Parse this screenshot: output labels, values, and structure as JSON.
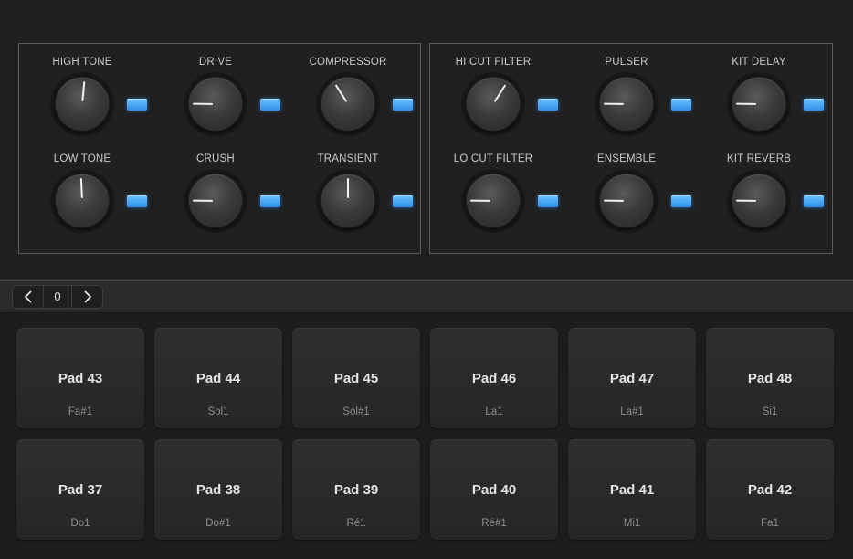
{
  "effects_left": [
    {
      "label": "HIGH TONE",
      "value": 0.52
    },
    {
      "label": "DRIVE",
      "value": 0.17
    },
    {
      "label": "COMPRESSOR",
      "value": 0.38
    },
    {
      "label": "LOW TONE",
      "value": 0.49
    },
    {
      "label": "CRUSH",
      "value": 0.17
    },
    {
      "label": "TRANSIENT",
      "value": 0.5
    }
  ],
  "effects_right": [
    {
      "label": "HI CUT FILTER",
      "value": 0.62
    },
    {
      "label": "PULSER",
      "value": 0.17
    },
    {
      "label": "KIT DELAY",
      "value": 0.17
    },
    {
      "label": "LO CUT FILTER",
      "value": 0.17
    },
    {
      "label": "ENSEMBLE",
      "value": 0.17
    },
    {
      "label": "KIT REVERB",
      "value": 0.17
    }
  ],
  "colors": {
    "led": "#3aa0f5",
    "panel_border": "#5c5c5f",
    "pad": "#2a2a2c"
  },
  "nav": {
    "prev_icon": "chevron-left-icon",
    "value": "0",
    "next_icon": "chevron-right-icon"
  },
  "pads": [
    {
      "name": "Pad 43",
      "note": "Fa#1"
    },
    {
      "name": "Pad 44",
      "note": "Sol1"
    },
    {
      "name": "Pad 45",
      "note": "Sol#1"
    },
    {
      "name": "Pad 46",
      "note": "La1"
    },
    {
      "name": "Pad 47",
      "note": "La#1"
    },
    {
      "name": "Pad 48",
      "note": "Si1"
    },
    {
      "name": "Pad 37",
      "note": "Do1"
    },
    {
      "name": "Pad 38",
      "note": "Do#1"
    },
    {
      "name": "Pad 39",
      "note": "Ré1"
    },
    {
      "name": "Pad 40",
      "note": "Ré#1"
    },
    {
      "name": "Pad 41",
      "note": "Mi1"
    },
    {
      "name": "Pad 42",
      "note": "Fa1"
    }
  ]
}
